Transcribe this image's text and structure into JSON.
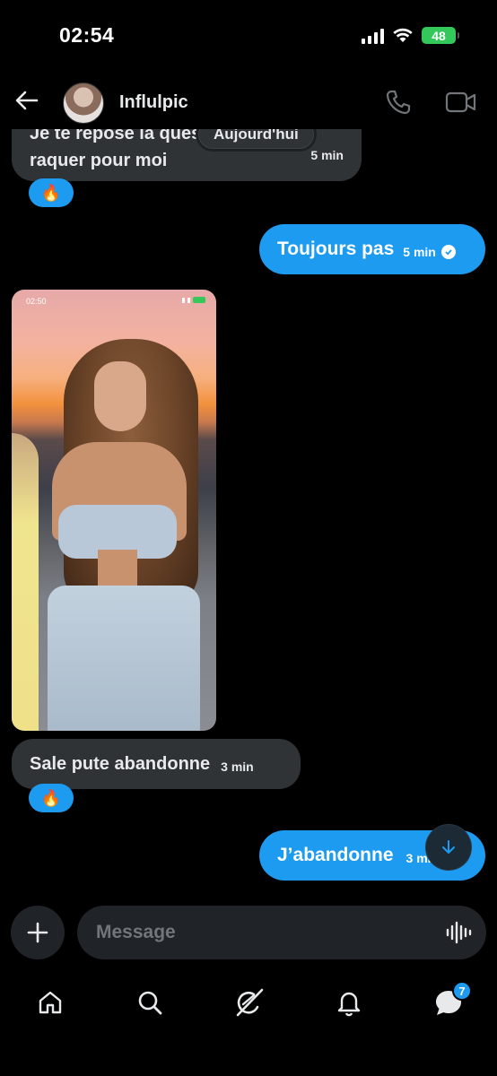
{
  "status_bar": {
    "time": "02:54",
    "battery": "48"
  },
  "header": {
    "contact_name": "Influlpic"
  },
  "messages": [
    {
      "direction": "in",
      "line1": "Je te repose la question, tu veux",
      "line2": "raquer pour moi",
      "time": "5 min",
      "reaction": "🔥"
    },
    {
      "direction": "out",
      "text": "Toujours pas",
      "time": "5 min",
      "read": true
    },
    {
      "direction": "in",
      "type": "image",
      "photo_time": "02:50"
    },
    {
      "direction": "in",
      "text": "Sale pute abandonne",
      "time": "3 min",
      "reaction": "🔥"
    },
    {
      "direction": "out",
      "text": "J’abandonne",
      "time": "3 min",
      "read": true
    }
  ],
  "date_separator": "Aujourd'hui",
  "composer": {
    "placeholder": "Message"
  },
  "tabbar": {
    "messages_badge": "7"
  },
  "icons": {
    "back": "back-arrow-icon",
    "call": "phone-icon",
    "video": "video-icon",
    "add": "plus-icon",
    "voice": "voice-waveform-icon",
    "tabs": [
      "home-icon",
      "search-icon",
      "grok-icon",
      "bell-icon",
      "messages-icon"
    ],
    "scroll": "arrow-down-icon"
  },
  "colors": {
    "accent": "#1d9bf0",
    "incoming_bubble": "#2f3336",
    "background": "#000000"
  }
}
